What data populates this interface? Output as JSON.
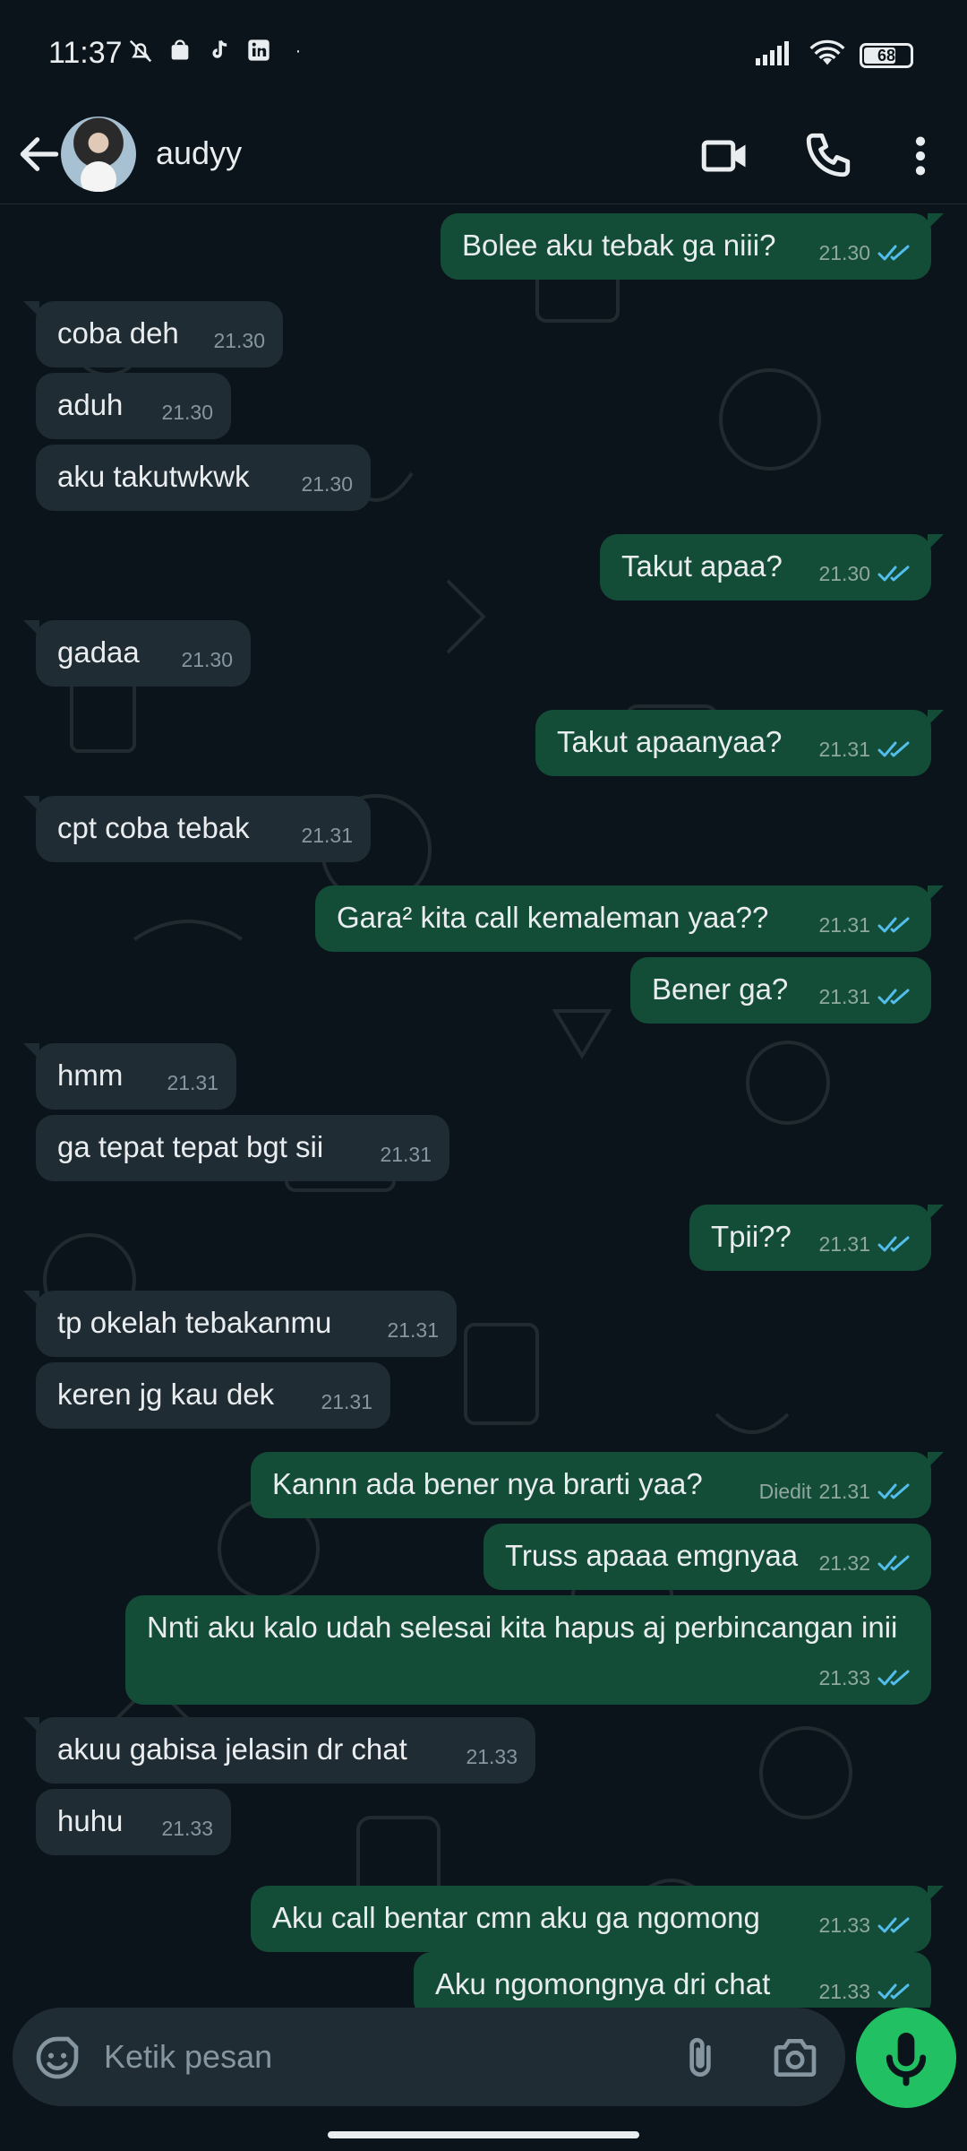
{
  "status_bar": {
    "time": "11:37",
    "battery": "68",
    "battery_level": 0.68
  },
  "header": {
    "contact_name": "audyy"
  },
  "messages": [
    {
      "dir": "out",
      "text": "Bolee aku tebak ga niii?",
      "time": "21.30"
    },
    {
      "dir": "in",
      "text": "coba deh",
      "time": "21.30"
    },
    {
      "dir": "in",
      "text": "aduh",
      "time": "21.30"
    },
    {
      "dir": "in",
      "text": "aku takutwkwk",
      "time": "21.30"
    },
    {
      "dir": "out",
      "text": "Takut apaa?",
      "time": "21.30"
    },
    {
      "dir": "in",
      "text": "gadaa",
      "time": "21.30"
    },
    {
      "dir": "out",
      "text": "Takut apaanyaa?",
      "time": "21.31"
    },
    {
      "dir": "in",
      "text": "cpt coba tebak",
      "time": "21.31"
    },
    {
      "dir": "out",
      "text": "Gara² kita call kemaleman yaa??",
      "time": "21.31"
    },
    {
      "dir": "out",
      "text": "Bener ga?",
      "time": "21.31"
    },
    {
      "dir": "in",
      "text": "hmm",
      "time": "21.31"
    },
    {
      "dir": "in",
      "text": "ga tepat tepat bgt sii",
      "time": "21.31"
    },
    {
      "dir": "out",
      "text": "Tpii??",
      "time": "21.31"
    },
    {
      "dir": "in",
      "text": "tp okelah tebakanmu",
      "time": "21.31"
    },
    {
      "dir": "in",
      "text": "keren jg kau dek",
      "time": "21.31"
    },
    {
      "dir": "out",
      "text": "Kannn ada bener nya brarti yaa?",
      "time": "21.31",
      "edited": "Diedit"
    },
    {
      "dir": "out",
      "text": "Truss apaaa emgnyaa",
      "time": "21.32"
    },
    {
      "dir": "out",
      "text": "Nnti aku kalo udah selesai kita hapus aj perbincangan inii",
      "time": "21.33"
    },
    {
      "dir": "in",
      "text": "akuu gabisa jelasin dr chat",
      "time": "21.33"
    },
    {
      "dir": "in",
      "text": "huhu",
      "time": "21.33"
    },
    {
      "dir": "out",
      "text": "Aku call bentar cmn aku ga ngomong",
      "time": "21.33"
    },
    {
      "dir": "out",
      "text": "Aku ngomongnya dri chat",
      "time": "21.33"
    }
  ],
  "input": {
    "placeholder": "Ketik pesan"
  },
  "colors": {
    "background": "#0b141a",
    "bubble_out": "#144d37",
    "bubble_in": "#202c33",
    "read_tick": "#53bdeb",
    "accent": "#21c063"
  },
  "icons": [
    "back-arrow-icon",
    "video-call-icon",
    "voice-call-icon",
    "more-options-icon",
    "emoji-icon",
    "attach-icon",
    "camera-icon",
    "mic-icon",
    "scroll-down-icon"
  ]
}
